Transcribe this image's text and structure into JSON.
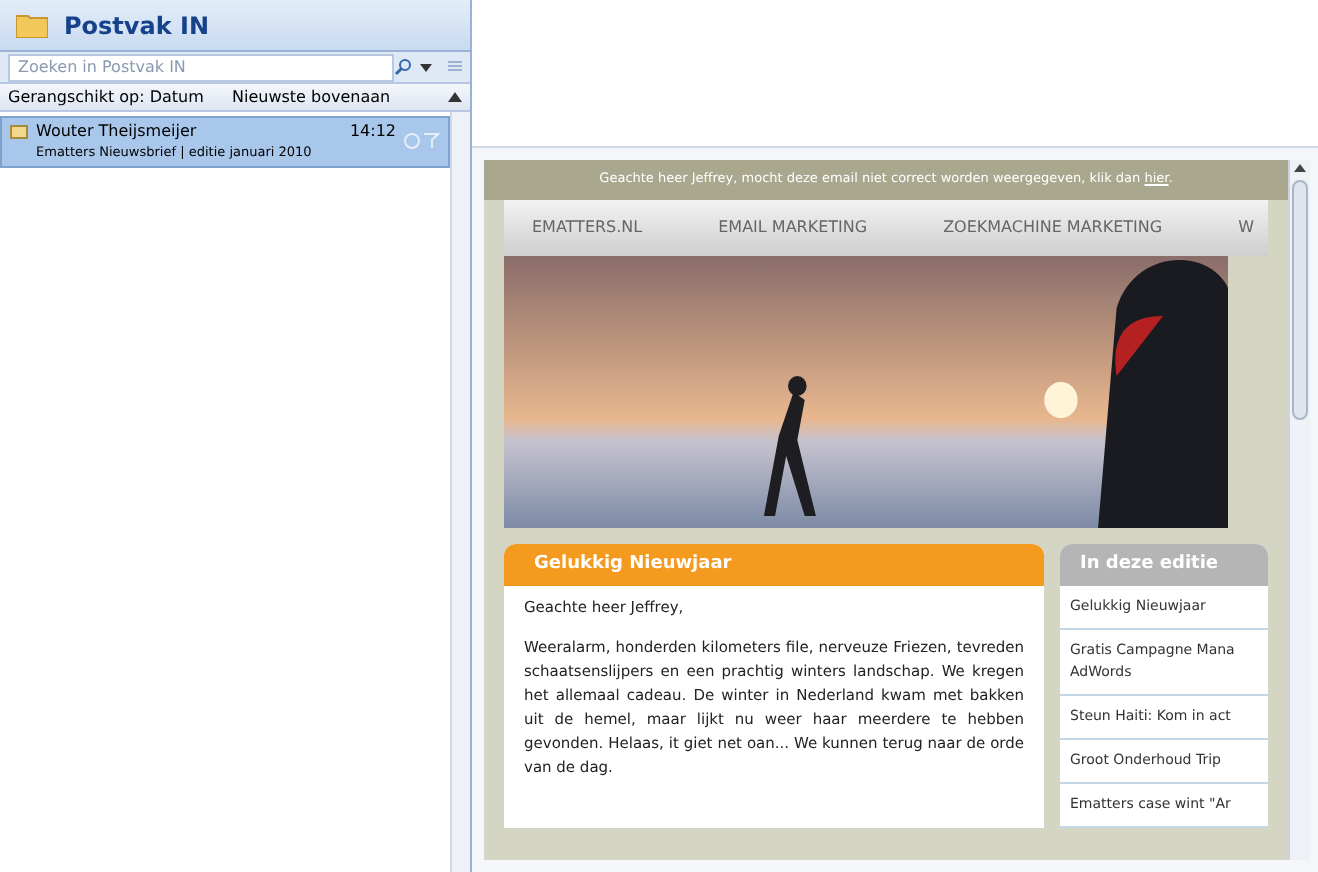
{
  "folder": {
    "title": "Postvak IN"
  },
  "search": {
    "placeholder": "Zoeken in Postvak IN"
  },
  "sort": {
    "label": "Gerangschikt op: Datum",
    "order": "Nieuwste bovenaan"
  },
  "messages": [
    {
      "sender": "Wouter Theijsmeijer",
      "time": "14:12",
      "subject": "Ematters Nieuwsbrief | editie januari 2010",
      "selected": true
    }
  ],
  "email": {
    "notice": "Geachte heer Jeffrey, mocht deze email niet correct worden weergegeven, klik dan",
    "notice_link": "hier",
    "notice_end": ".",
    "nav": [
      "EMATTERS.NL",
      "EMAIL MARKETING",
      "ZOEKMACHINE MARKETING",
      "W"
    ],
    "article": {
      "title": "Gelukkig Nieuwjaar",
      "paragraphs": [
        "Geachte heer Jeffrey,",
        "Weeralarm, honderden kilometers file, nerveuze Friezen, tevreden schaatsenslijpers en een prachtig winters landschap. We kregen het allemaal cadeau. De winter in Nederland kwam met bakken uit de hemel, maar lijkt nu weer haar meerdere te hebben gevonden. Helaas, it giet net oan... We kunnen terug naar de orde van de dag."
      ]
    },
    "sidebar": {
      "title": "In deze editie",
      "items": [
        "Gelukkig Nieuwjaar",
        "Gratis Campagne Mana AdWords",
        "Steun Haiti: Kom in act",
        "Groot Onderhoud Trip",
        "Ematters case wint \"Ar"
      ]
    }
  }
}
